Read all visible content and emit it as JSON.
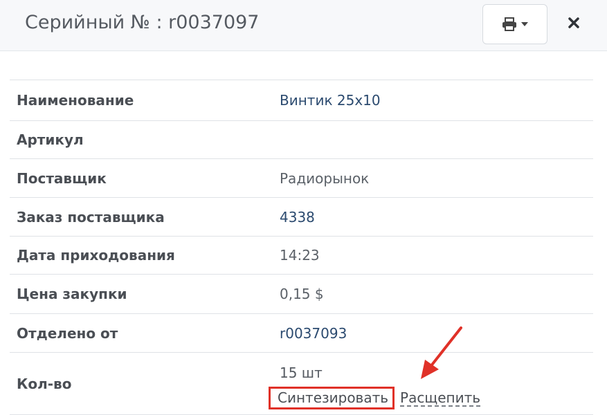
{
  "header": {
    "title": "Серийный № : r0037097",
    "print_icon": "printer-icon",
    "dropdown_icon": "caret-down-icon",
    "close_icon": "close-icon"
  },
  "rows": [
    {
      "label": "Наименование",
      "value": "Винтик 25x10"
    },
    {
      "label": "Артикул",
      "value": ""
    },
    {
      "label": "Поставщик",
      "value": "Радиорынок"
    },
    {
      "label": "Заказ поставщика",
      "value": "4338"
    },
    {
      "label": "Дата приходования",
      "value": "14:23"
    },
    {
      "label": "Цена закупки",
      "value": "0,15 $"
    },
    {
      "label": "Отделено от",
      "value": "r0037093"
    }
  ],
  "quantity": {
    "label": "Кол-во",
    "value": "15 шт",
    "synthesize_label": "Синтезировать",
    "split_label": "Расщепить"
  },
  "colors": {
    "highlight": "#e03128",
    "link": "#2b4a6f"
  }
}
